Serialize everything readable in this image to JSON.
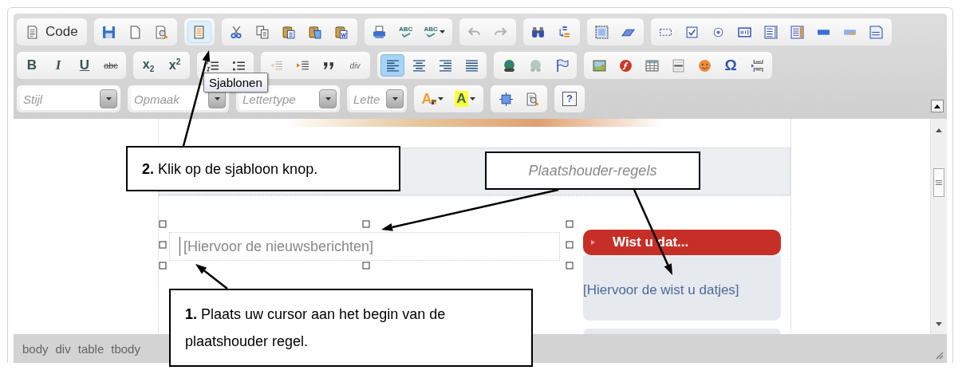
{
  "toolbar": {
    "rows": [
      [
        {
          "buttons": [
            {
              "kind": "code",
              "label": "Code"
            }
          ]
        },
        {
          "buttons": [
            {
              "kind": "save"
            },
            {
              "kind": "new-page"
            },
            {
              "kind": "preview"
            }
          ]
        },
        {
          "buttons": [
            {
              "kind": "templates",
              "hovered": true
            }
          ]
        },
        {
          "buttons": [
            {
              "kind": "cut"
            },
            {
              "kind": "copy"
            },
            {
              "kind": "paste"
            },
            {
              "kind": "paste-text"
            },
            {
              "kind": "paste-word"
            }
          ]
        },
        {
          "buttons": [
            {
              "kind": "print"
            },
            {
              "kind": "spellcheck",
              "label": "ABC"
            },
            {
              "kind": "spellcheck-menu",
              "label": "ABC"
            }
          ]
        },
        {
          "buttons": [
            {
              "kind": "undo",
              "disabled": true
            },
            {
              "kind": "redo",
              "disabled": true
            }
          ]
        },
        {
          "buttons": [
            {
              "kind": "find"
            },
            {
              "kind": "replace"
            }
          ]
        },
        {
          "buttons": [
            {
              "kind": "select-all"
            },
            {
              "kind": "remove-format"
            }
          ]
        },
        {
          "buttons": [
            {
              "kind": "form"
            },
            {
              "kind": "checkbox"
            },
            {
              "kind": "radio"
            },
            {
              "kind": "text-field"
            },
            {
              "kind": "textarea"
            },
            {
              "kind": "select"
            },
            {
              "kind": "button"
            },
            {
              "kind": "image-button"
            },
            {
              "kind": "hidden-field"
            }
          ]
        }
      ],
      [
        {
          "buttons": [
            {
              "kind": "bold",
              "label": "B"
            },
            {
              "kind": "italic",
              "label": "I"
            },
            {
              "kind": "underline",
              "label": "U"
            },
            {
              "kind": "strike",
              "label": "abc"
            }
          ]
        },
        {
          "buttons": [
            {
              "kind": "subscript",
              "label": "x$_{2}$"
            },
            {
              "kind": "superscript",
              "label": "x$^{2}$"
            }
          ]
        },
        {
          "buttons": [
            {
              "kind": "ordered-list"
            },
            {
              "kind": "bullet-list"
            }
          ]
        },
        {
          "buttons": [
            {
              "kind": "outdent",
              "disabled": true
            },
            {
              "kind": "indent",
              "disabled": false
            },
            {
              "kind": "blockquote",
              "disabled": false
            },
            {
              "kind": "div",
              "label": "div",
              "disabled": false
            }
          ]
        },
        {
          "buttons": [
            {
              "kind": "align-left",
              "selected": true
            },
            {
              "kind": "align-center",
              "selected": false
            },
            {
              "kind": "align-right",
              "selected": false
            },
            {
              "kind": "justify",
              "selected": false
            }
          ]
        },
        {
          "buttons": [
            {
              "kind": "link",
              "disabled": false
            },
            {
              "kind": "unlink",
              "disabled": true
            },
            {
              "kind": "anchor",
              "disabled": false
            }
          ]
        },
        {
          "buttons": [
            {
              "kind": "image"
            },
            {
              "kind": "flash"
            },
            {
              "kind": "table"
            },
            {
              "kind": "rule"
            },
            {
              "kind": "smiley"
            },
            {
              "kind": "special-char",
              "label": "Ω"
            },
            {
              "kind": "page-break"
            }
          ]
        }
      ],
      [
        {
          "buttons": [
            {
              "kind": "combo",
              "label": "Stijl"
            }
          ]
        },
        {
          "buttons": [
            {
              "kind": "combo",
              "label": "Opmaak"
            }
          ]
        },
        {
          "buttons": [
            {
              "kind": "combo",
              "label": "Lettertype"
            }
          ]
        },
        {
          "buttons": [
            {
              "kind": "combo",
              "label": "Lette"
            }
          ]
        },
        {
          "buttons": [
            {
              "kind": "text-color",
              "label": "A"
            },
            {
              "kind": "bg-color",
              "label": "A"
            }
          ]
        },
        {
          "buttons": [
            {
              "kind": "maximize"
            },
            {
              "kind": "show-blocks"
            }
          ]
        },
        {
          "buttons": [
            {
              "kind": "help",
              "label": "?"
            }
          ]
        }
      ]
    ]
  },
  "tooltip": {
    "text": "Sjablonen"
  },
  "editor": {
    "news_placeholder": "[Hiervoor de nieuwsberichten]",
    "sidebar": {
      "title": "Wist u dat...",
      "placeholder": "[Hiervoor de wist u datjes]"
    }
  },
  "status_bar": {
    "path": [
      "body",
      "div",
      "table",
      "tbody"
    ]
  },
  "callouts": [
    {
      "kind": "step",
      "text": "**2.** Klik op de sjabloon knop."
    },
    {
      "kind": "note",
      "text": "Plaatshouder-regels"
    },
    {
      "kind": "step",
      "text": "**1.** Plaats uw cursor aan het begin van de plaatshouder regel."
    }
  ]
}
